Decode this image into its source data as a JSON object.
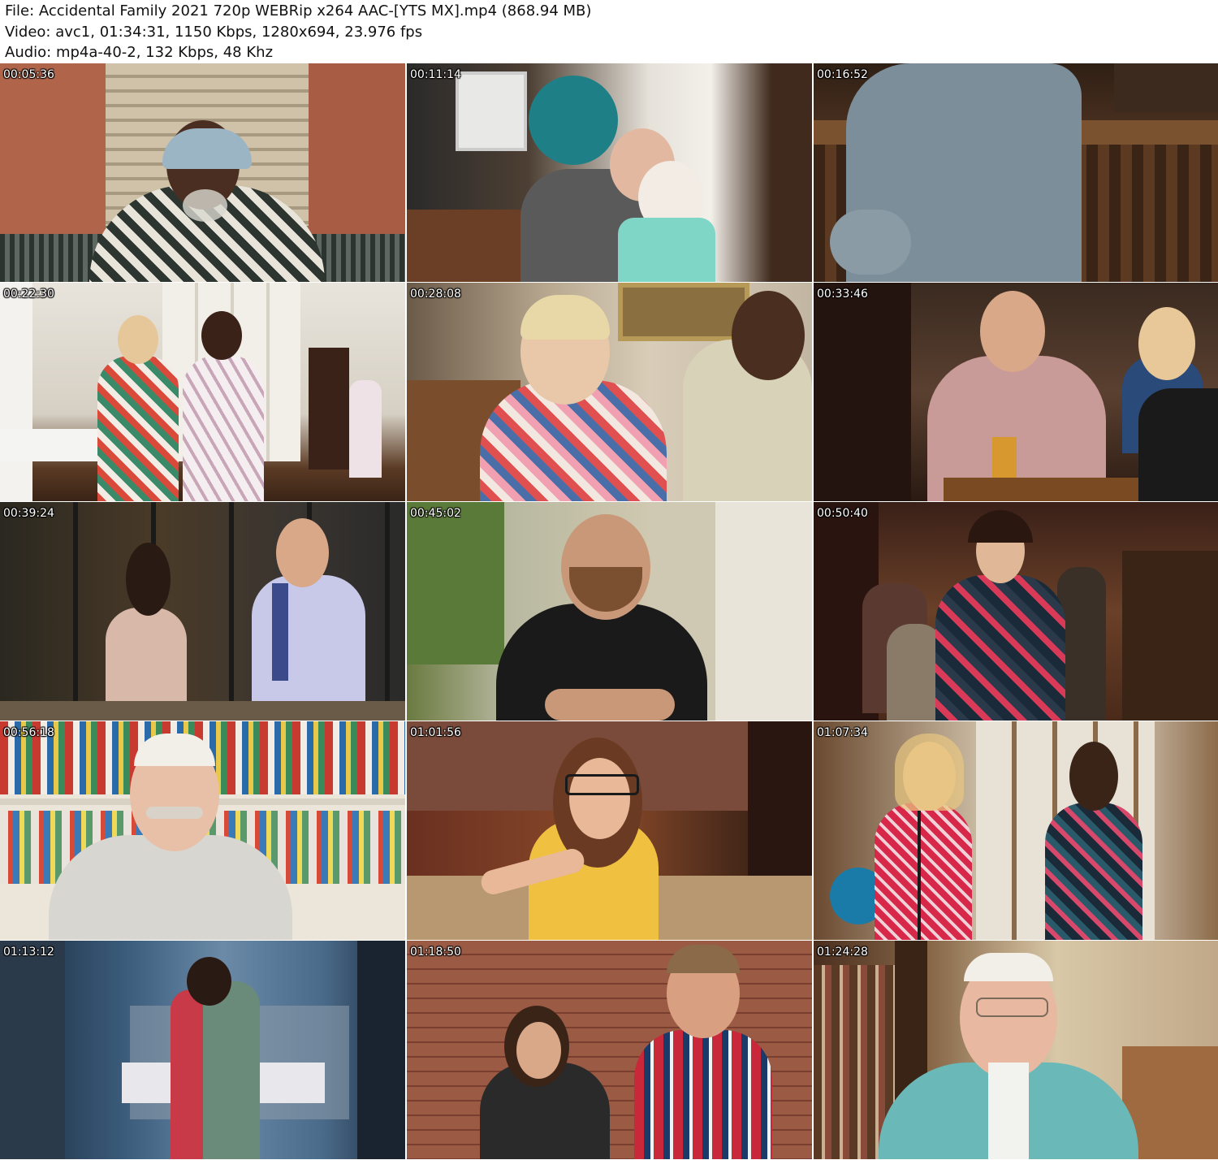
{
  "header": {
    "file_line": "File: Accidental Family 2021 720p WEBRip x264 AAC-[YTS MX].mp4 (868.94 MB)",
    "video_line": "Video: avc1, 01:34:31, 1150 Kbps, 1280x694, 23.976 fps",
    "audio_line": "Audio: mp4a-40-2, 132 Kbps, 48 Khz"
  },
  "thumbnails": [
    {
      "timestamp": "00:05:36"
    },
    {
      "timestamp": "00:11:14"
    },
    {
      "timestamp": "00:16:52"
    },
    {
      "timestamp": "00:22:30"
    },
    {
      "timestamp": "00:28:08"
    },
    {
      "timestamp": "00:33:46"
    },
    {
      "timestamp": "00:39:24"
    },
    {
      "timestamp": "00:45:02"
    },
    {
      "timestamp": "00:50:40"
    },
    {
      "timestamp": "00:56:18"
    },
    {
      "timestamp": "01:01:56"
    },
    {
      "timestamp": "01:07:34"
    },
    {
      "timestamp": "01:13:12"
    },
    {
      "timestamp": "01:18:50"
    },
    {
      "timestamp": "01:24:28"
    }
  ]
}
